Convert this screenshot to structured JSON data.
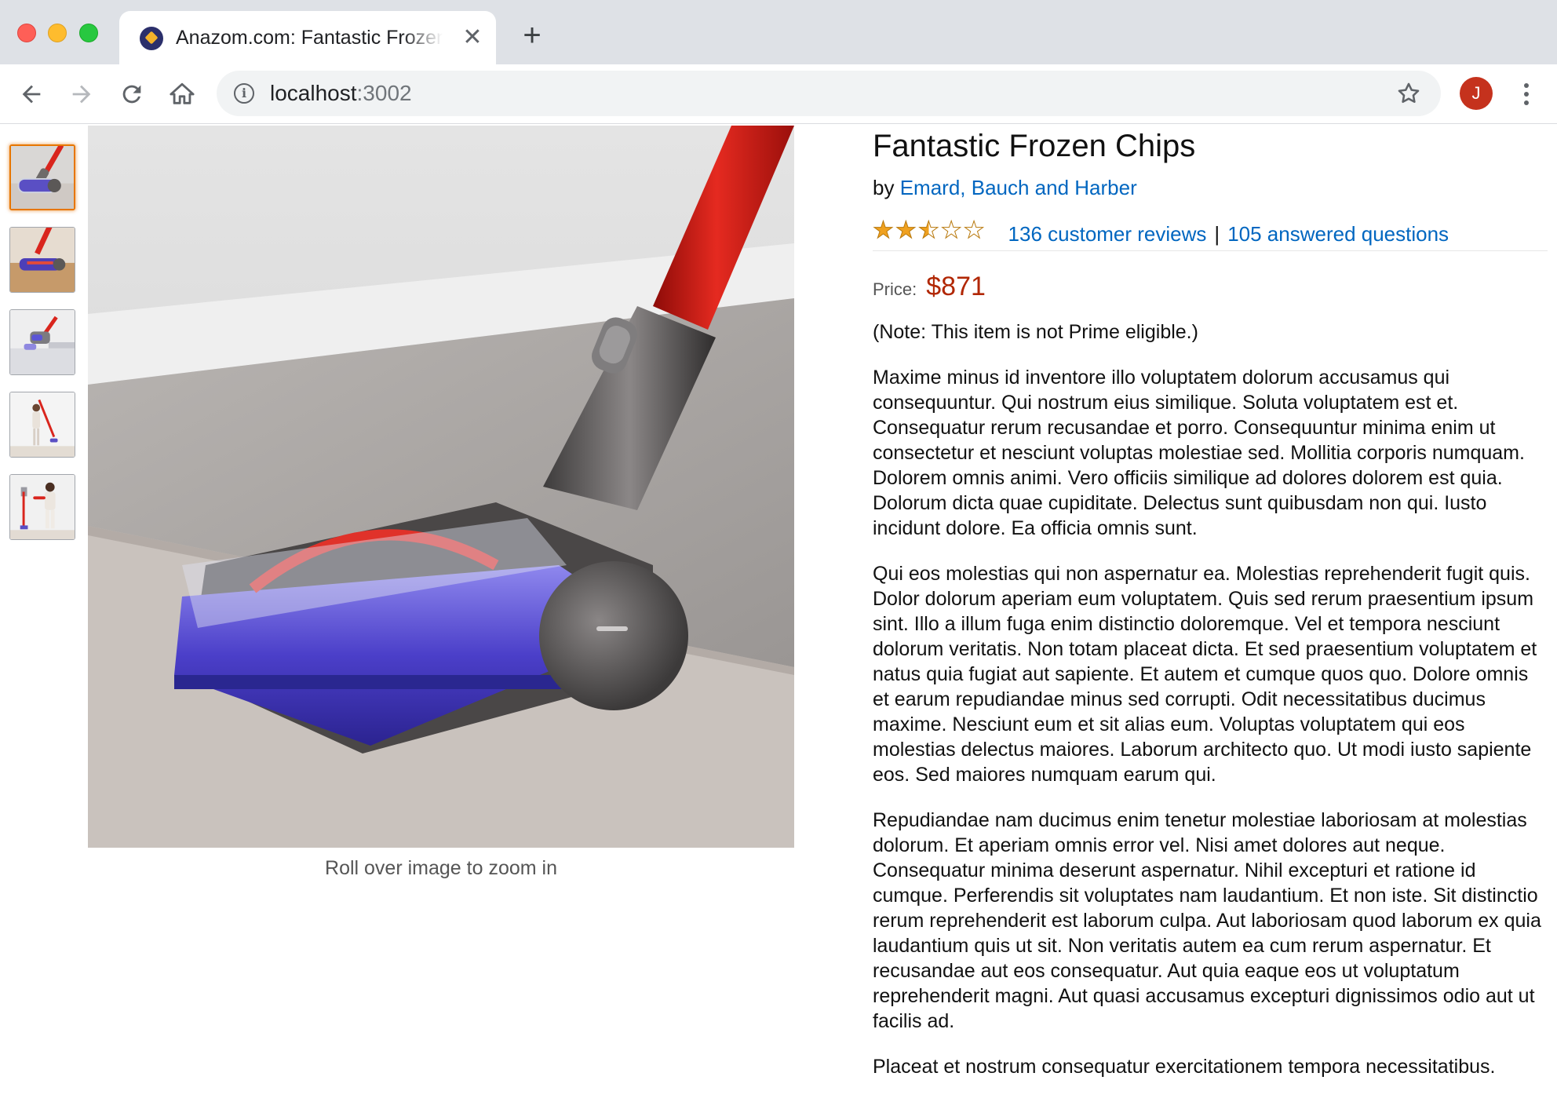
{
  "browser": {
    "tab_title": "Anazom.com: Fantastic Frozen Chips",
    "close_glyph": "✕",
    "new_tab_glyph": "+",
    "url_host": "localhost",
    "url_port": ":3002",
    "avatar_initial": "J",
    "icons": [
      "back-arrow-icon",
      "forward-arrow-icon",
      "reload-icon",
      "home-icon",
      "info-icon",
      "bookmark-star-icon",
      "kebab-menu-icon"
    ]
  },
  "product": {
    "title": "Fantastic Frozen Chips",
    "by_prefix": "by",
    "brand": "Emard, Bauch and Harber",
    "rating": 2.5,
    "rating_max": 5,
    "reviews_link": "136 customer reviews",
    "separator": "|",
    "questions_link": "105 answered questions",
    "price_label": "Price:",
    "price": "$871",
    "prime_note": "(Note: This item is not Prime eligible.)",
    "description": [
      "Maxime minus id inventore illo voluptatem dolorum accusamus qui consequuntur. Qui nostrum eius similique. Soluta voluptatem est et. Consequatur rerum recusandae et porro. Consequuntur minima enim ut consectetur et nesciunt voluptas molestiae sed. Mollitia corporis numquam. Dolorem omnis animi. Vero officiis similique ad dolores dolorem est quia. Dolorum dicta quae cupiditate. Delectus sunt quibusdam non qui. Iusto incidunt dolore. Ea officia omnis sunt.",
      "Qui eos molestias qui non aspernatur ea. Molestias reprehenderit fugit quis. Dolor dolorum aperiam eum voluptatem. Quis sed rerum praesentium ipsum sint. Illo a illum fuga enim distinctio doloremque. Vel et tempora nesciunt dolorum veritatis. Non totam placeat dicta. Et sed praesentium voluptatem et natus quia fugiat aut sapiente. Et autem et cumque quos quo. Dolore omnis et earum repudiandae minus sed corrupti. Odit necessitatibus ducimus maxime. Nesciunt eum et sit alias eum. Voluptas voluptatem qui eos molestias delectus maiores. Laborum architecto quo. Ut modi iusto sapiente eos. Sed maiores numquam earum qui.",
      "Repudiandae nam ducimus enim tenetur molestiae laboriosam at molestias dolorum. Et aperiam omnis error vel. Nisi amet dolores aut neque. Consequatur minima deserunt aspernatur. Nihil excepturi et ratione id cumque. Perferendis sit voluptates nam laudantium. Et non iste. Sit distinctio rerum reprehenderit est laborum culpa. Aut laboriosam quod laborum ex quia laudantium quis ut sit. Non veritatis autem ea cum rerum aspernatur. Et recusandae aut eos consequatur. Aut quia eaque eos ut voluptatum reprehenderit magni. Aut quasi accusamus excepturi dignissimos odio aut ut facilis ad.",
      "Placeat et nostrum consequatur exercitationem tempora necessitatibus."
    ]
  },
  "gallery": {
    "zoom_hint": "Roll over image to zoom in",
    "thumbnails": [
      "vacuum-head-closeup",
      "vacuum-head-on-floor",
      "vacuum-handheld-on-stairs",
      "woman-vacuuming-standing",
      "woman-with-wall-dock"
    ],
    "selected_index": 0
  },
  "colors": {
    "link": "#0066c0",
    "price": "#b12704",
    "star": "#f0a11f",
    "selected_thumb_border": "#e77600"
  }
}
